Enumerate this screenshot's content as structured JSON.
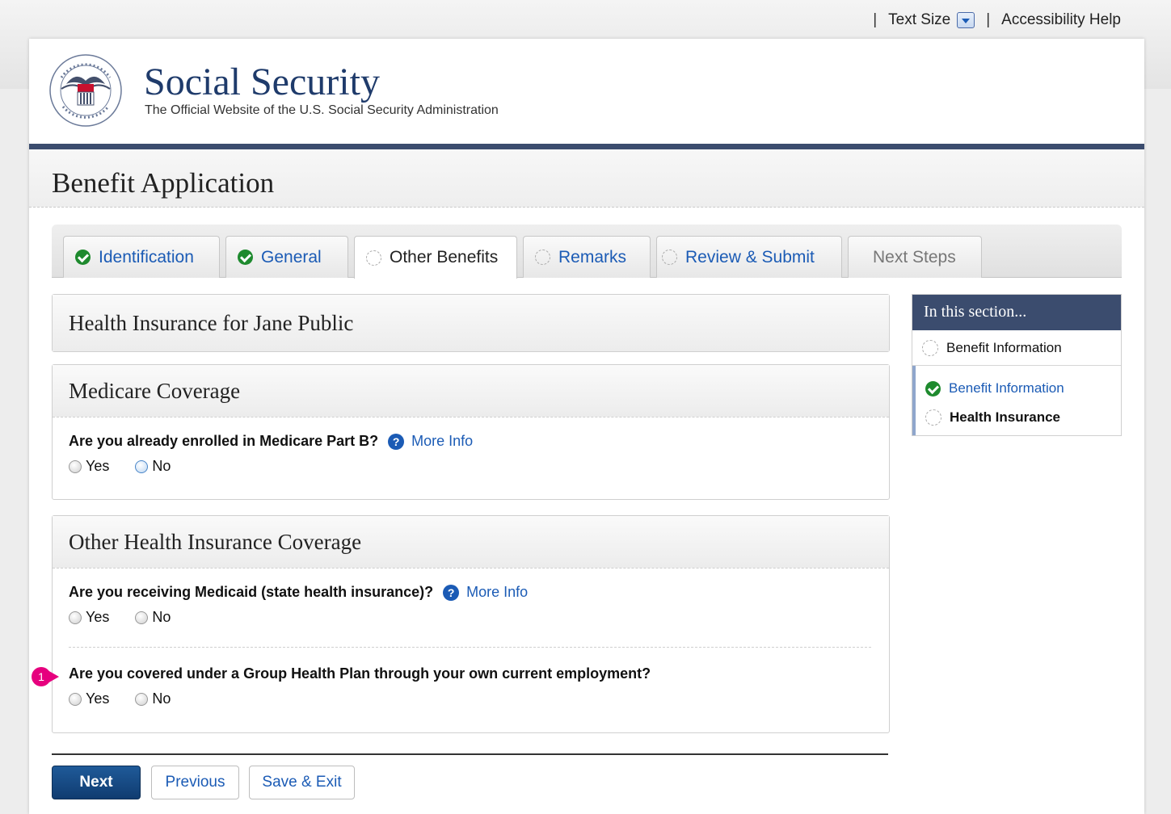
{
  "utility": {
    "separator": "|",
    "text_size_label": "Text Size",
    "accessibility_label": "Accessibility Help"
  },
  "header": {
    "seal_alt": "Social Security Administration seal",
    "title": "Social Security",
    "subtitle": "The Official Website of the U.S. Social Security Administration"
  },
  "app": {
    "title": "Benefit Application"
  },
  "tabs": [
    {
      "label": "Identification",
      "status": "complete"
    },
    {
      "label": "General",
      "status": "complete"
    },
    {
      "label": "Other Benefits",
      "status": "current"
    },
    {
      "label": "Remarks",
      "status": "incomplete"
    },
    {
      "label": "Review & Submit",
      "status": "incomplete"
    },
    {
      "label": "Next Steps",
      "status": "disabled"
    }
  ],
  "panels": {
    "health_title": "Health Insurance for Jane Public",
    "medicare": {
      "title": "Medicare Coverage",
      "question": "Are you already enrolled in Medicare Part B?",
      "help": "?",
      "more_info": "More Info",
      "yes": "Yes",
      "no": "No"
    },
    "other": {
      "title": "Other Health Insurance Coverage",
      "q1": "Are you receiving Medicaid (state health insurance)?",
      "help": "?",
      "more_info": "More Info",
      "q1_yes": "Yes",
      "q1_no": "No",
      "q2": "Are you covered under a Group Health Plan through your own current employment?",
      "q2_yes": "Yes",
      "q2_no": "No",
      "marker": "1"
    }
  },
  "sidebar": {
    "title": "In this section...",
    "items": [
      {
        "label": "Benefit Information",
        "status": "incomplete"
      },
      {
        "label": "Benefit Information",
        "status": "complete"
      },
      {
        "label": "Health Insurance",
        "status": "current"
      }
    ]
  },
  "buttons": {
    "next": "Next",
    "previous": "Previous",
    "save_exit": "Save & Exit"
  },
  "colors": {
    "brand": "#1f3b6b",
    "link": "#1b5bb5",
    "header_rule": "#3b4c6e",
    "complete": "#1e8a2e",
    "marker": "#e6007e"
  }
}
